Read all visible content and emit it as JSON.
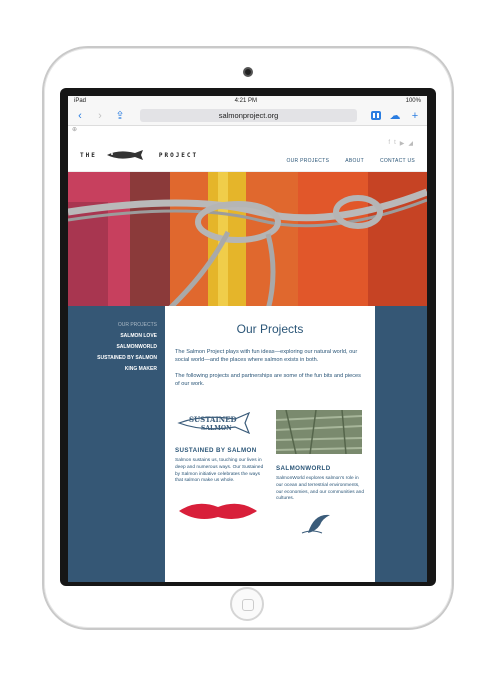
{
  "statusbar": {
    "device": "iPad",
    "time": "4:21 PM",
    "battery": "100%"
  },
  "browser": {
    "url": "salmonproject.org"
  },
  "site": {
    "logo_left": "THE",
    "logo_right": "PROJECT",
    "nav": [
      "OUR PROJECTS",
      "ABOUT",
      "CONTACT US"
    ],
    "social_icons": [
      "facebook-icon",
      "twitter-icon",
      "youtube-icon",
      "rss-icon"
    ]
  },
  "sidebar": {
    "items": [
      "OUR PROJECTS",
      "SALMON LOVE",
      "SALMONWORLD",
      "SUSTAINED BY SALMON",
      "KING MAKER"
    ]
  },
  "page": {
    "title": "Our Projects",
    "intro1": "The Salmon Project plays with fun ideas—exploring our natural world, our social world—and the places where salmon exists in both.",
    "intro2": "The following projects and partnerships are some of the fun bits and pieces of our work.",
    "projects": [
      {
        "logo_line1": "SUSTAINED",
        "logo_line2": "SALMON",
        "title": "SUSTAINED BY SALMON",
        "desc": "Salmon sustains us, touching our lives in deep and numerous ways. Our Sustained by Salmon initiative celebrates the ways that salmon make us whole."
      },
      {
        "title": "SALMONWORLD",
        "desc": "SalmonWorld explores salmon's role in our ocean and terrestrial environments, our economies, and our communities and cultures."
      }
    ]
  },
  "colors": {
    "navy": "#355775",
    "accent": "#2a7de1",
    "orange": "#d95a2a"
  }
}
